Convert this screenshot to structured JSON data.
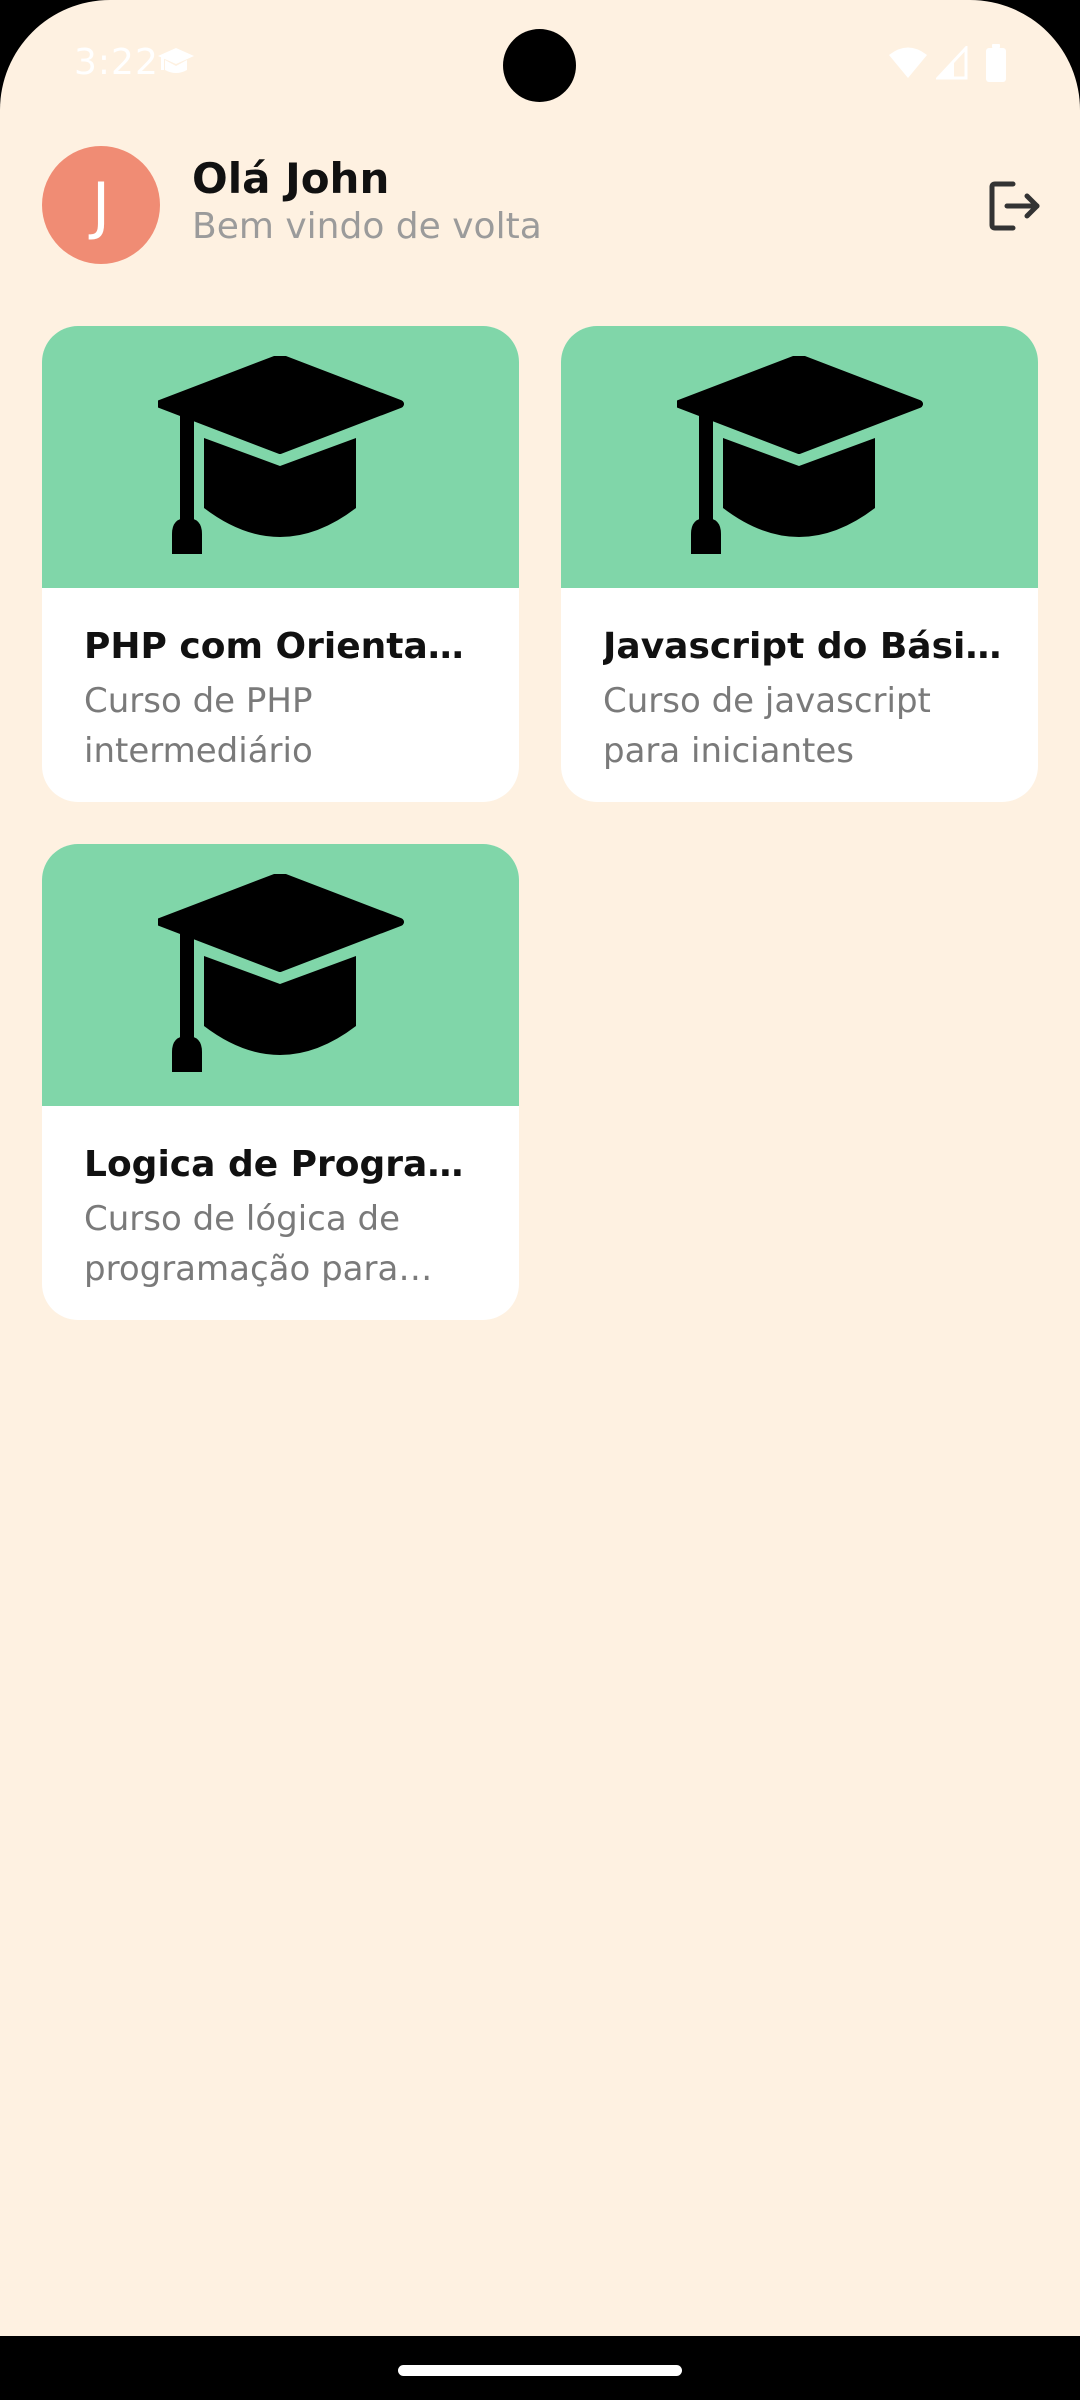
{
  "status_bar": {
    "time": "3:22",
    "icons": [
      "graduation-cap-icon",
      "wifi-icon",
      "signal-icon",
      "battery-icon"
    ]
  },
  "header": {
    "avatar_initial": "J",
    "greeting": "Olá John",
    "subtitle": "Bem vindo de volta",
    "logout_icon": "logout-icon"
  },
  "colors": {
    "background": "#fef1e1",
    "avatar": "#f08c74",
    "card_banner": "#80d6a9",
    "card": "#ffffff"
  },
  "courses": [
    {
      "title": "PHP com Orientação a Objetos",
      "description": "Curso de PHP intermediário",
      "icon": "graduation-cap-icon"
    },
    {
      "title": "Javascript do Básico",
      "description": "Curso de javascript para iniciantes",
      "icon": "graduation-cap-icon"
    },
    {
      "title": "Logica de Programação",
      "description": "Curso de lógica de programação para iniciantes",
      "icon": "graduation-cap-icon"
    }
  ]
}
